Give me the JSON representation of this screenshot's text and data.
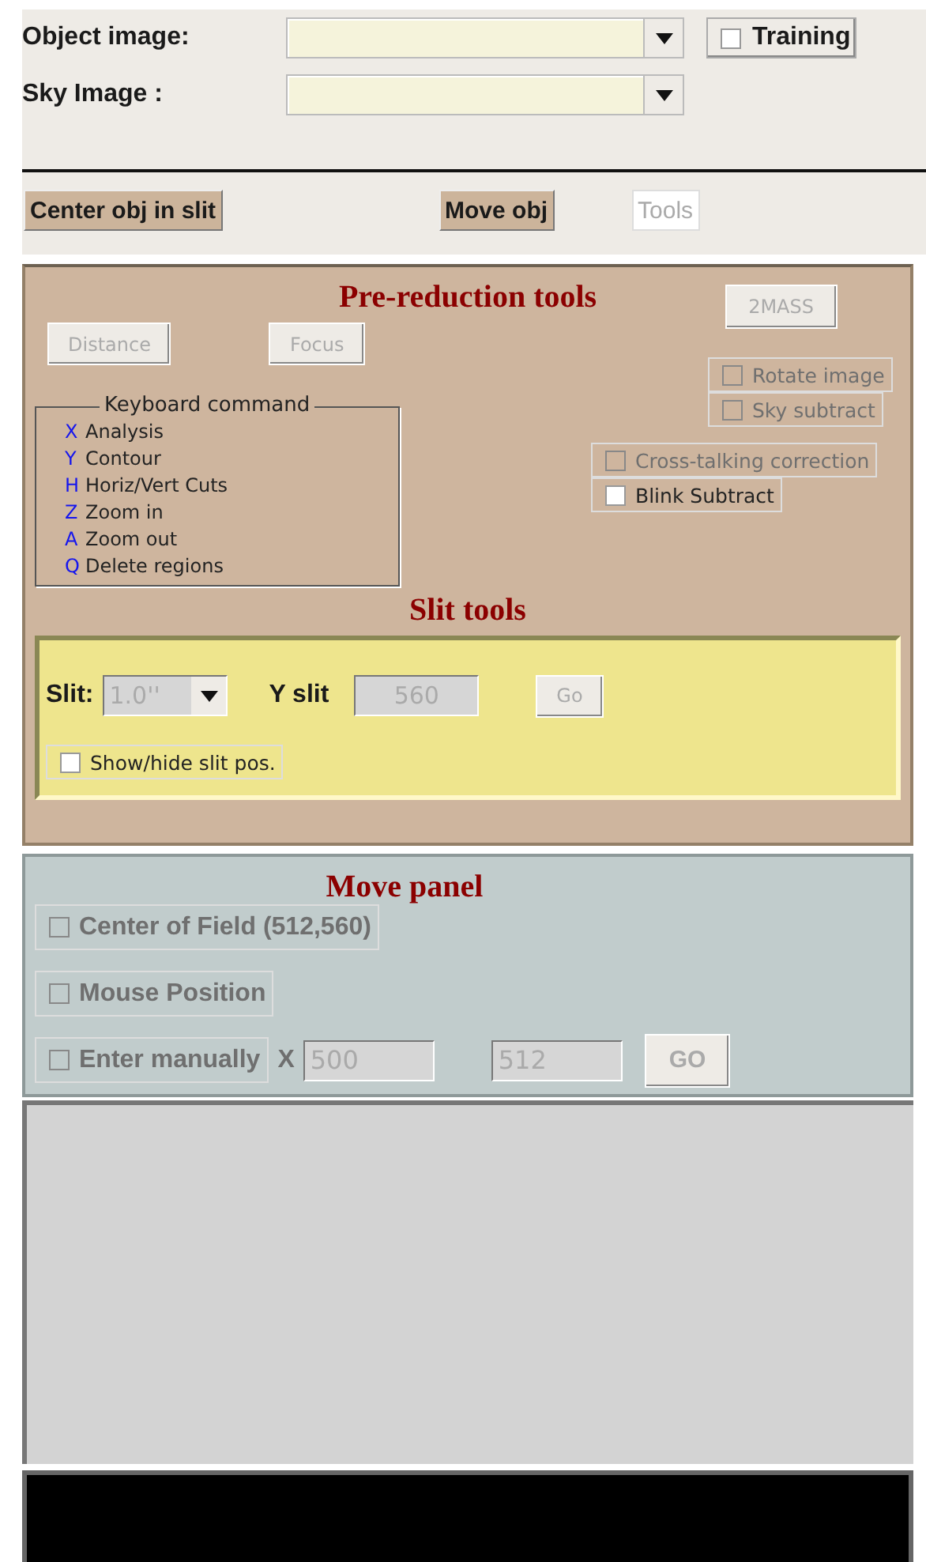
{
  "file_selectors": [
    {
      "label": "Object image:"
    },
    {
      "label": "Sky Image :"
    }
  ],
  "training": {
    "label": "Training",
    "checked": false
  },
  "actions": [
    {
      "label": "Center obj in slit",
      "disabled": false
    },
    {
      "label": "Move obj",
      "disabled": false
    },
    {
      "label": "Tools",
      "disabled": true
    }
  ],
  "pre_reduction": {
    "title": "Pre-reduction tools",
    "buttons": [
      {
        "label": "Distance",
        "disabled": true
      },
      {
        "label": "Focus",
        "disabled": true
      }
    ],
    "two_mass": {
      "label": "2MASS",
      "disabled": true
    },
    "options": [
      {
        "label": "Rotate image",
        "checked": false,
        "disabled": true
      },
      {
        "label": "Sky subtract",
        "checked": false,
        "disabled": true
      },
      {
        "label": "Cross-talking correction",
        "checked": false,
        "disabled": true
      },
      {
        "label": "Blink Subtract",
        "checked": false,
        "disabled": false
      }
    ],
    "keyboard": {
      "title": "Keyboard command",
      "commands": [
        {
          "key": "X",
          "action": "Analysis"
        },
        {
          "key": "Y",
          "action": "Contour"
        },
        {
          "key": "H",
          "action": "Horiz/Vert Cuts"
        },
        {
          "key": "Z",
          "action": "Zoom in"
        },
        {
          "key": "A",
          "action": "Zoom out"
        },
        {
          "key": "Q",
          "action": "Delete regions"
        }
      ]
    }
  },
  "slit_tools": {
    "title": "Slit tools",
    "slit_label": "Slit:",
    "slit_value": "1.0''",
    "y_label": "Y slit",
    "y_value": "560",
    "go": {
      "label": "Go",
      "disabled": true
    },
    "show_slit": {
      "label": "Show/hide slit pos.",
      "checked": false,
      "disabled": false
    }
  },
  "move_panel": {
    "title": "Move panel",
    "options": [
      {
        "label": "Center of Field (512,560)",
        "checked": false,
        "disabled": true
      },
      {
        "label": "Mouse Position",
        "checked": false,
        "disabled": true
      },
      {
        "label": "Enter manually",
        "checked": false,
        "disabled": true
      }
    ],
    "x_label": "X",
    "x_value": "500",
    "y_value": "512",
    "go": {
      "label": "GO",
      "disabled": true
    }
  }
}
